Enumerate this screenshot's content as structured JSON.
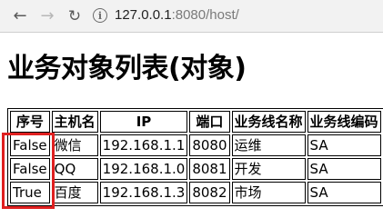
{
  "browser": {
    "url_host": "127.0.0.1",
    "url_rest": ":8080/host/"
  },
  "page": {
    "title": "业务对象列表(对象)"
  },
  "table": {
    "headers": [
      "序号",
      "主机名",
      "IP",
      "端口",
      "业务线名称",
      "业务线编码"
    ],
    "rows": [
      [
        "False",
        "微信",
        "192.168.1.1",
        "8080",
        "运维",
        "SA"
      ],
      [
        "False",
        "QQ",
        "192.168.1.0",
        "8081",
        "开发",
        "SA"
      ],
      [
        "True",
        "百度",
        "192.168.1.3",
        "8082",
        "市场",
        "SA"
      ]
    ]
  },
  "annotation": {
    "highlight_color": "#e02020"
  },
  "icons": {
    "back": "arrow-left-icon",
    "forward": "arrow-right-icon",
    "reload": "reload-icon",
    "site_info": "info-icon"
  }
}
